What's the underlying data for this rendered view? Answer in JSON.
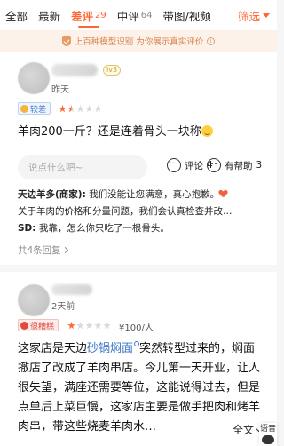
{
  "tabs": [
    {
      "label": "全部",
      "count": ""
    },
    {
      "label": "最新",
      "count": ""
    },
    {
      "label": "差评",
      "count": "29"
    },
    {
      "label": "中评",
      "count": "64"
    },
    {
      "label": "带图/视频",
      "count": ""
    }
  ],
  "filter": {
    "label": "筛选"
  },
  "banner": {
    "text": "上百种模型识别 为你展示真实评价"
  },
  "reviews": [
    {
      "level": "lv3",
      "time": "昨天",
      "rating_label": "较差",
      "stars": 1.5,
      "text": "羊肉200一斤？还是连着骨头一块称",
      "comment_placeholder": "说点什么吧~",
      "comment_label": "评论",
      "comment_count": "4",
      "helpful_label": "有帮助",
      "helpful_count": "3",
      "merchant_name": "天边羊多(商家):",
      "merchant_line1": " 我们没能让您满意，真心抱歉。",
      "merchant_line2": "关于羊肉的价格和分量问题，我们会认真检查并改…",
      "reply2_name": "SD:",
      "reply2_text": " 我靠，怎么你只吃了一根骨头。",
      "reply_total": "共4条回复"
    },
    {
      "time": "2天前",
      "rating_label": "很糟糕",
      "stars": 1,
      "price": "¥100/人",
      "text_a": "这家店是天边",
      "text_link": "砂锅焖面",
      "text_b": "突然转型过来的，焖面撤店了改成了羊肉串店。今儿第一天开业，让人很失望，满座还需要等位，这能说得过去，但是点单后上菜巨慢，这家店主要是做手把肉和烤羊肉串，带这些烧麦羊肉水…",
      "fulltext_label": "全文"
    }
  ],
  "voice": {
    "label": "语音"
  },
  "colors": {
    "accent": "#ff6633",
    "link": "#3b74c6"
  }
}
